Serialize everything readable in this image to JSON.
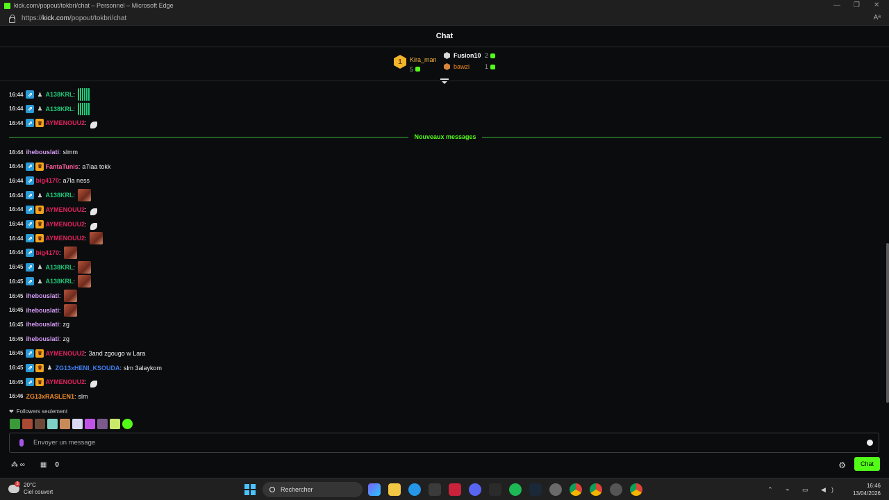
{
  "window": {
    "title": "kick.com/popout/tokbri/chat – Personnel – Microsoft Edge",
    "url_prefix": "https://",
    "url_domain": "kick.com",
    "url_path": "/popout/tokbri/chat"
  },
  "chat": {
    "header": "Chat",
    "new_messages_label": "Nouveaux messages",
    "followers_only": "Followers seulement",
    "input_placeholder": "Envoyer un message",
    "send_button": "Chat",
    "points_count": "0"
  },
  "leaderboard": {
    "first": {
      "rank": "1",
      "name": "Kira_man",
      "count": "5"
    },
    "second": {
      "name": "Fusion10",
      "count": "2"
    },
    "third": {
      "name": "bawzi",
      "count": "1"
    }
  },
  "messages_before": [
    {
      "time": "16:44",
      "badges": [
        "sub",
        "pers"
      ],
      "user": "A138KRL",
      "color": "#1fc97a",
      "text": "",
      "emote": "dots"
    },
    {
      "time": "16:44",
      "badges": [
        "sub",
        "pers"
      ],
      "user": "A138KRL",
      "color": "#1fc97a",
      "text": "",
      "emote": "dots"
    },
    {
      "time": "16:44",
      "badges": [
        "sub",
        "vip"
      ],
      "user": "AYMENOUU2",
      "color": "#e0245e",
      "text": "",
      "emote": "feather"
    }
  ],
  "messages_after": [
    {
      "time": "16:44",
      "badges": [],
      "user": "ihebouslati",
      "color": "#d59cf6",
      "text": "slmm",
      "emote": ""
    },
    {
      "time": "16:44",
      "badges": [
        "sub",
        "vip"
      ],
      "user": "FantaTunis",
      "color": "#ff5fa2",
      "text": "a7laa tokk",
      "emote": ""
    },
    {
      "time": "16:44",
      "badges": [
        "sub"
      ],
      "user": "big4170",
      "color": "#e0245e",
      "text": "a7la ness",
      "emote": ""
    },
    {
      "time": "16:44",
      "badges": [
        "sub",
        "pers"
      ],
      "user": "A138KRL",
      "color": "#1fc97a",
      "text": "",
      "emote": "face"
    },
    {
      "time": "16:44",
      "badges": [
        "sub",
        "vip"
      ],
      "user": "AYMENOUU2",
      "color": "#e0245e",
      "text": "",
      "emote": "feather"
    },
    {
      "time": "16:44",
      "badges": [
        "sub",
        "vip"
      ],
      "user": "AYMENOUU2",
      "color": "#e0245e",
      "text": "",
      "emote": "feather"
    },
    {
      "time": "16:44",
      "badges": [
        "sub",
        "vip"
      ],
      "user": "AYMENOUU2",
      "color": "#e0245e",
      "text": "",
      "emote": "face"
    },
    {
      "time": "16:44",
      "badges": [
        "sub"
      ],
      "user": "big4170",
      "color": "#e0245e",
      "text": "",
      "emote": "face"
    },
    {
      "time": "16:45",
      "badges": [
        "sub",
        "pers"
      ],
      "user": "A138KRL",
      "color": "#1fc97a",
      "text": "",
      "emote": "face"
    },
    {
      "time": "16:45",
      "badges": [
        "sub",
        "pers"
      ],
      "user": "A138KRL",
      "color": "#1fc97a",
      "text": "",
      "emote": "face"
    },
    {
      "time": "16:45",
      "badges": [],
      "user": "ihebouslati",
      "color": "#d59cf6",
      "text": "",
      "emote": "face"
    },
    {
      "time": "16:45",
      "badges": [],
      "user": "ihebouslati",
      "color": "#d59cf6",
      "text": "",
      "emote": "face"
    },
    {
      "time": "16:45",
      "badges": [],
      "user": "ihebouslati",
      "color": "#d59cf6",
      "text": "zg",
      "emote": ""
    },
    {
      "time": "16:45",
      "badges": [],
      "user": "ihebouslati",
      "color": "#d59cf6",
      "text": "zg",
      "emote": ""
    },
    {
      "time": "16:45",
      "badges": [
        "sub",
        "vip"
      ],
      "user": "AYMENOUU2",
      "color": "#e0245e",
      "text": "3and zgougo w Lara",
      "emote": ""
    },
    {
      "time": "16:45",
      "badges": [
        "sub",
        "vip",
        "pers"
      ],
      "user": "ZG13xHENI_KSOUDA",
      "color": "#3f7ff2",
      "text": "slm 3alaykom",
      "emote": ""
    },
    {
      "time": "16:45",
      "badges": [
        "sub",
        "vip"
      ],
      "user": "AYMENOUU2",
      "color": "#e0245e",
      "text": "",
      "emote": "feather"
    },
    {
      "time": "16:46",
      "badges": [],
      "user": "ZG13xRASLEN1",
      "color": "#f28c28",
      "text": "slm",
      "emote": ""
    }
  ],
  "taskbar": {
    "temp": "20°C",
    "weather": "Ciel couvert",
    "search": "Rechercher",
    "time": "16:46",
    "date": "13/04/2026"
  }
}
